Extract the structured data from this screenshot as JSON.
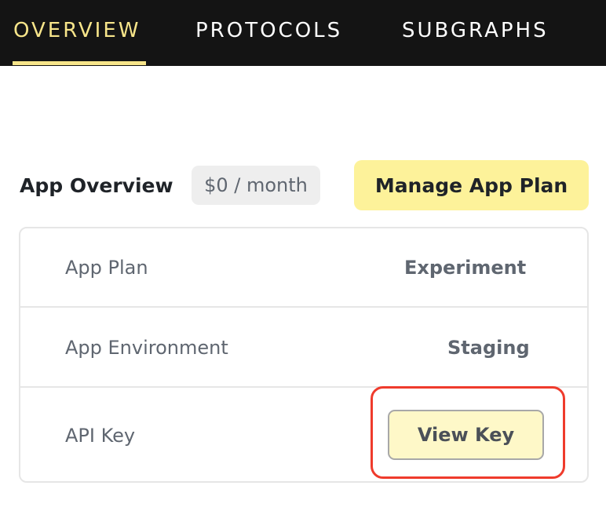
{
  "nav": {
    "tabs": [
      {
        "label": "OVERVIEW",
        "active": true
      },
      {
        "label": "PROTOCOLS",
        "active": false
      },
      {
        "label": "SUBGRAPHS",
        "active": false
      }
    ],
    "active_color": "#f7e58a",
    "background": "#141414"
  },
  "header": {
    "title": "App Overview",
    "price": "$0 / month",
    "manage_button_label": "Manage App Plan"
  },
  "details": {
    "rows": [
      {
        "label": "App Plan",
        "value": "Experiment"
      },
      {
        "label": "App Environment",
        "value": "Staging"
      },
      {
        "label": "API Key",
        "button_label": "View Key"
      }
    ]
  },
  "colors": {
    "accent_yellow": "#fdf29a",
    "highlight_red": "#ef3b2c"
  }
}
